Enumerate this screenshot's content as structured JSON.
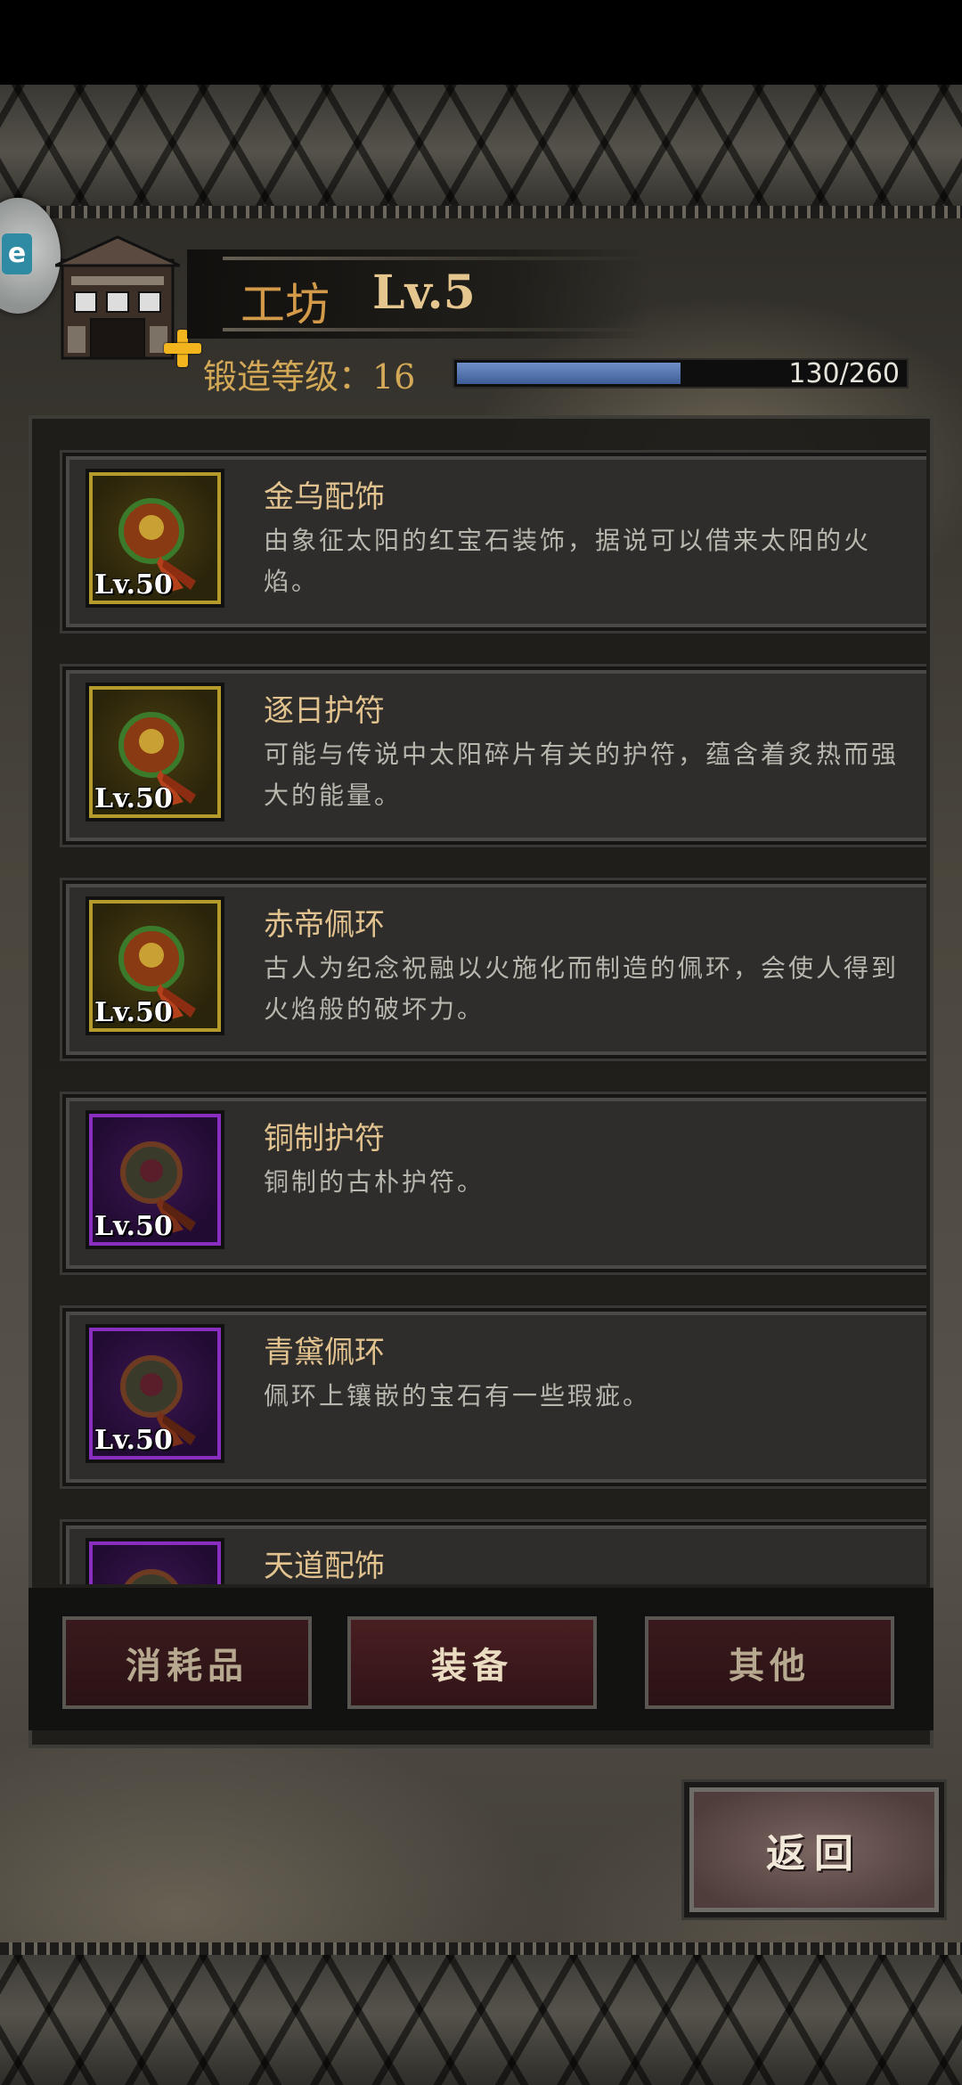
{
  "header": {
    "workshop_name": "工坊",
    "workshop_level": "Lv.5",
    "forge_label": "锻造等级：16",
    "exp_text": "130/260",
    "exp_fraction": 0.5,
    "side_badge_text": "e"
  },
  "items": [
    {
      "name": "金乌配饰",
      "desc": "由象征太阳的红宝石装饰，据说可以借来太阳的火焰。",
      "level": "Lv.50",
      "rarity": "gold"
    },
    {
      "name": "逐日护符",
      "desc": "可能与传说中太阳碎片有关的护符，蕴含着炙热而强大的能量。",
      "level": "Lv.50",
      "rarity": "gold"
    },
    {
      "name": "赤帝佩环",
      "desc": "古人为纪念祝融以火施化而制造的佩环，会使人得到火焰般的破坏力。",
      "level": "Lv.50",
      "rarity": "gold"
    },
    {
      "name": "铜制护符",
      "desc": "铜制的古朴护符。",
      "level": "Lv.50",
      "rarity": "purple"
    },
    {
      "name": "青黛佩环",
      "desc": "佩环上镶嵌的宝石有一些瑕疵。",
      "level": "Lv.50",
      "rarity": "purple"
    },
    {
      "name": "天道配饰",
      "desc": "",
      "level": "",
      "rarity": "purple"
    }
  ],
  "tabs": [
    {
      "label": "消耗品",
      "active": false
    },
    {
      "label": "装备",
      "active": true
    },
    {
      "label": "其他",
      "active": false
    }
  ],
  "back_label": "返回",
  "colors": {
    "gold_frame": "#b59a2c",
    "purple_frame": "#8a2ec2",
    "name_text": "#e2c38f",
    "exp_fill": "#4f6fa8"
  }
}
